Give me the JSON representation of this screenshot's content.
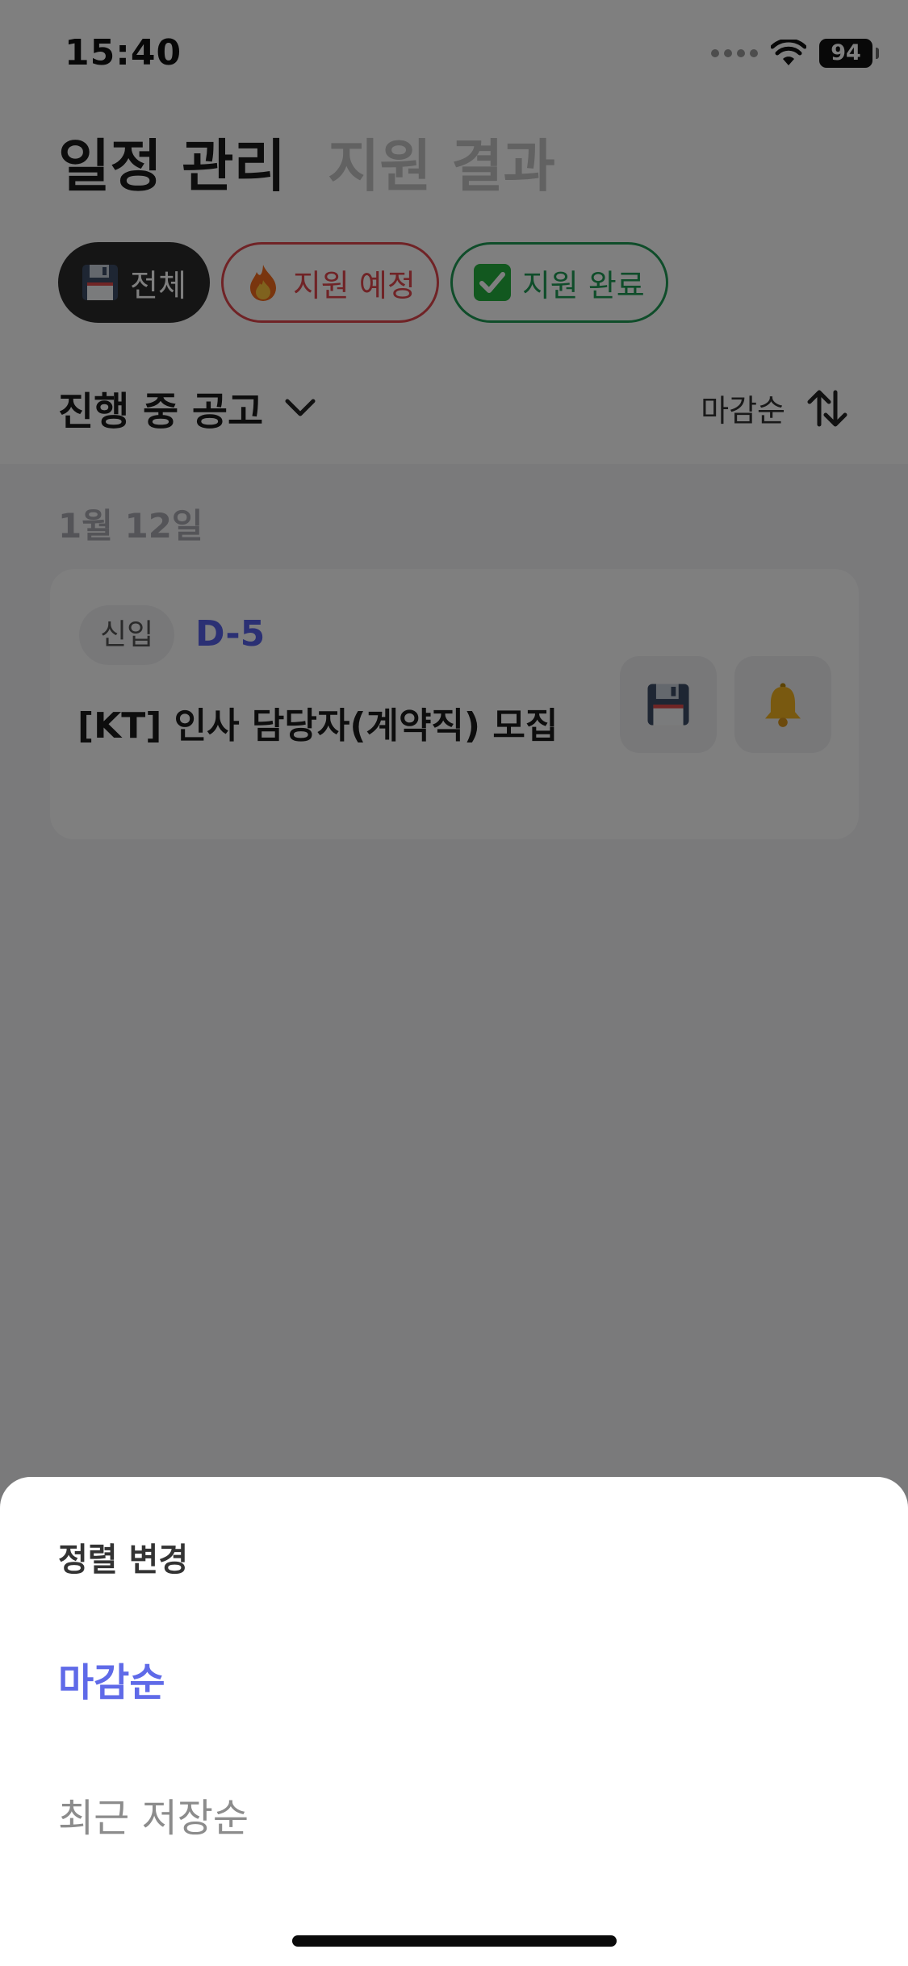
{
  "status_bar": {
    "time": "15:40",
    "battery": "94"
  },
  "header": {
    "tabs": [
      {
        "label": "일정 관리",
        "active": true
      },
      {
        "label": "지원 결과",
        "active": false
      }
    ]
  },
  "filters": [
    {
      "label": "전체",
      "icon": "floppy-disk-icon",
      "selected": true
    },
    {
      "label": "지원 예정",
      "icon": "fire-icon",
      "selected": false
    },
    {
      "label": "지원 완료",
      "icon": "check-box-icon",
      "selected": false
    }
  ],
  "list_header": {
    "title": "진행 중 공고",
    "sort_label": "마감순"
  },
  "date_group": {
    "date": "1월 12일"
  },
  "job_card": {
    "badge": "신입",
    "dday": "D-5",
    "title": "[KT] 인사 담당자(계약직) 모집"
  },
  "sort_sheet": {
    "title": "정렬 변경",
    "options": [
      {
        "label": "마감순",
        "selected": true
      },
      {
        "label": "최근 저장순",
        "selected": false
      }
    ]
  },
  "colors": {
    "accent": "#5f6ae8",
    "dday": "#5660e8",
    "planned": "#e0474c",
    "done": "#1f9a55",
    "chip_selected_bg": "#2b2b2b",
    "dim_overlay": "rgba(0,0,0,0.5)"
  }
}
